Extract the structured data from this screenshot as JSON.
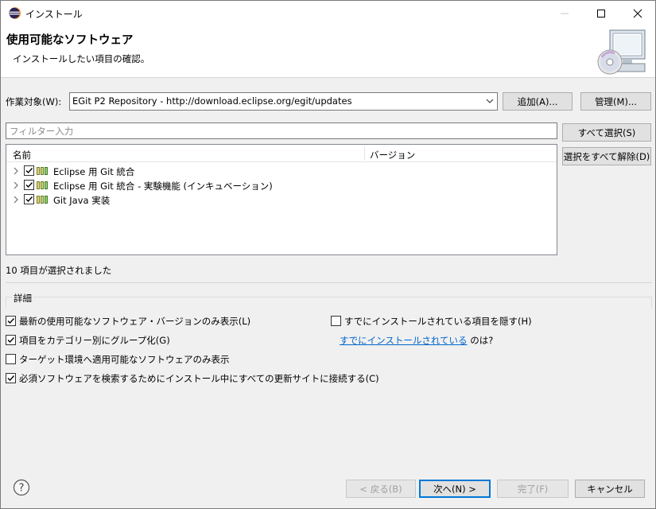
{
  "window": {
    "title": "インストール",
    "app_icon": "eclipse-icon"
  },
  "banner": {
    "title": "使用可能なソフトウェア",
    "subtitle": "インストールしたい項目の確認。",
    "image": "install-wizard-monitor-cd-icon"
  },
  "work_with": {
    "label": "作業対象(W):",
    "value": "EGit P2 Repository - http://download.eclipse.org/egit/updates",
    "add_button": "追加(A)...",
    "manage_button": "管理(M)..."
  },
  "filter": {
    "placeholder": "フィルター入力"
  },
  "side_buttons": {
    "select_all": "すべて選択(S)",
    "deselect_all": "選択をすべて解除(D)"
  },
  "tree": {
    "columns": [
      "名前",
      "バージョン"
    ],
    "rows": [
      {
        "label": "Eclipse 用 Git 統合",
        "checked": true,
        "icon": "feature-category-icon"
      },
      {
        "label": "Eclipse 用 Git 統合 - 実験機能 (インキュベーション)",
        "checked": true,
        "icon": "feature-category-icon"
      },
      {
        "label": "Git Java 実装",
        "checked": true,
        "icon": "feature-category-icon"
      }
    ]
  },
  "status": "10 項目が選択されました",
  "details": {
    "legend": "詳細",
    "show_latest": {
      "label": "最新の使用可能なソフトウェア・バージョンのみ表示(L)",
      "checked": true
    },
    "group_by_category": {
      "label": "項目をカテゴリー別にグループ化(G)",
      "checked": true
    },
    "target_only": {
      "label": "ターゲット環境へ適用可能なソフトウェアのみ表示",
      "checked": false
    },
    "contact_all": {
      "label": "必須ソフトウェアを検索するためにインストール中にすべての更新サイトに接続する(C)",
      "checked": true
    },
    "hide_installed": {
      "label": "すでにインストールされている項目を隠す(H)",
      "checked": false
    },
    "installed_link": "すでにインストールされている",
    "installed_suffix": " のは?"
  },
  "footer": {
    "back": "< 戻る(B)",
    "next": "次へ(N) >",
    "finish": "完了(F)",
    "cancel": "キャンセル"
  }
}
